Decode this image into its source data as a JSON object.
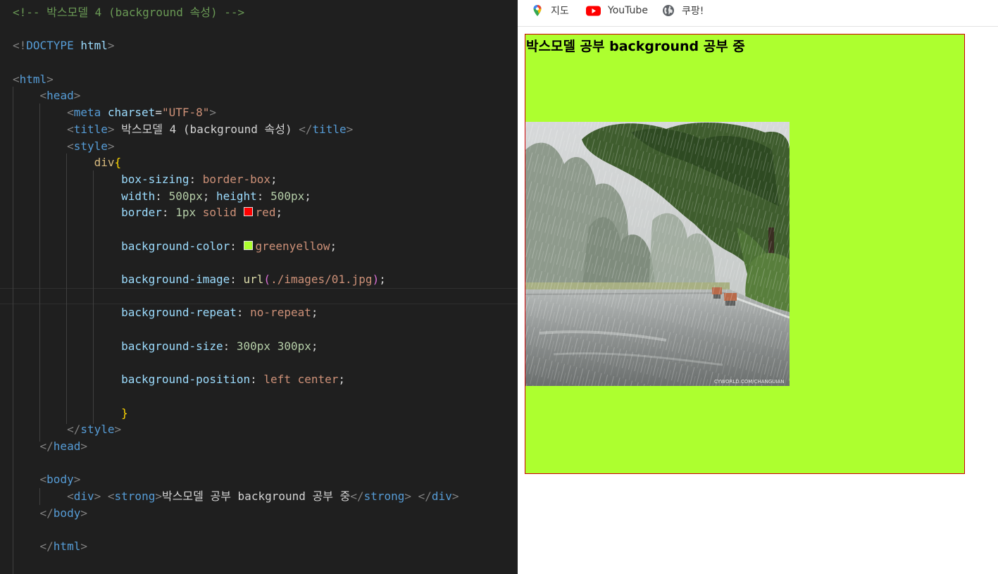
{
  "editor": {
    "lines": [
      [
        [
          "c-com",
          "<!-- 박스모델 4 (background 속성) -->"
        ]
      ],
      [],
      [
        [
          "c-br",
          "<!"
        ],
        [
          "c-tag",
          "DOCTYPE"
        ],
        [
          "c-txt",
          " "
        ],
        [
          "c-atn",
          "html"
        ],
        [
          "c-br",
          ">"
        ]
      ],
      [],
      [
        [
          "c-br",
          "<"
        ],
        [
          "c-tag",
          "html"
        ],
        [
          "c-br",
          ">"
        ]
      ],
      [
        [
          "c-txt",
          "    "
        ],
        [
          "c-br",
          "<"
        ],
        [
          "c-tag",
          "head"
        ],
        [
          "c-br",
          ">"
        ]
      ],
      [
        [
          "c-txt",
          "        "
        ],
        [
          "c-br",
          "<"
        ],
        [
          "c-tag",
          "meta"
        ],
        [
          "c-txt",
          " "
        ],
        [
          "c-atn",
          "charset"
        ],
        [
          "c-txt",
          "="
        ],
        [
          "c-atv",
          "\"UTF-8\""
        ],
        [
          "c-br",
          ">"
        ]
      ],
      [
        [
          "c-txt",
          "        "
        ],
        [
          "c-br",
          "<"
        ],
        [
          "c-tag",
          "title"
        ],
        [
          "c-br",
          ">"
        ],
        [
          "c-txt",
          " 박스모델 4 (background 속성) "
        ],
        [
          "c-br",
          "</"
        ],
        [
          "c-tag",
          "title"
        ],
        [
          "c-br",
          ">"
        ]
      ],
      [
        [
          "c-txt",
          "        "
        ],
        [
          "c-br",
          "<"
        ],
        [
          "c-tag",
          "style"
        ],
        [
          "c-br",
          ">"
        ]
      ],
      [
        [
          "c-txt",
          "            "
        ],
        [
          "c-sel",
          "div"
        ],
        [
          "c-brk",
          "{"
        ]
      ],
      [
        [
          "c-txt",
          "                "
        ],
        [
          "c-prp",
          "box-sizing"
        ],
        [
          "c-txt",
          ": "
        ],
        [
          "c-val",
          "border-box"
        ],
        [
          "c-txt",
          ";"
        ]
      ],
      [
        [
          "c-txt",
          "                "
        ],
        [
          "c-prp",
          "width"
        ],
        [
          "c-txt",
          ": "
        ],
        [
          "c-num",
          "500px"
        ],
        [
          "c-txt",
          "; "
        ],
        [
          "c-prp",
          "height"
        ],
        [
          "c-txt",
          ": "
        ],
        [
          "c-num",
          "500px"
        ],
        [
          "c-txt",
          ";"
        ]
      ],
      [
        [
          "c-txt",
          "                "
        ],
        [
          "c-prp",
          "border"
        ],
        [
          "c-txt",
          ": "
        ],
        [
          "c-num",
          "1px"
        ],
        [
          "c-txt",
          " "
        ],
        [
          "c-val",
          "solid"
        ],
        [
          "c-txt",
          " "
        ],
        [
          "swatch",
          "#ff0000"
        ],
        [
          "c-val",
          "red"
        ],
        [
          "c-txt",
          ";"
        ]
      ],
      [],
      [
        [
          "c-txt",
          "                "
        ],
        [
          "c-prp",
          "background-color"
        ],
        [
          "c-txt",
          ": "
        ],
        [
          "swatch",
          "#adff2f"
        ],
        [
          "c-val",
          "greenyellow"
        ],
        [
          "c-txt",
          ";"
        ]
      ],
      [],
      [
        [
          "c-txt",
          "                "
        ],
        [
          "c-prp",
          "background-image"
        ],
        [
          "c-txt",
          ": "
        ],
        [
          "c-fn",
          "url"
        ],
        [
          "c-brk2",
          "("
        ],
        [
          "c-val",
          "./images/01.jpg"
        ],
        [
          "c-brk2",
          ")"
        ],
        [
          "c-txt",
          ";"
        ]
      ],
      [],
      [
        [
          "c-txt",
          "                "
        ],
        [
          "c-prp",
          "background-repeat"
        ],
        [
          "c-txt",
          ": "
        ],
        [
          "c-val",
          "no-repeat"
        ],
        [
          "c-txt",
          ";"
        ]
      ],
      [],
      [
        [
          "c-txt",
          "                "
        ],
        [
          "c-prp",
          "background-size"
        ],
        [
          "c-txt",
          ": "
        ],
        [
          "c-num",
          "300px"
        ],
        [
          "c-txt",
          " "
        ],
        [
          "c-num",
          "300px"
        ],
        [
          "c-txt",
          ";"
        ]
      ],
      [],
      [
        [
          "c-txt",
          "                "
        ],
        [
          "c-prp",
          "background-position"
        ],
        [
          "c-txt",
          ": "
        ],
        [
          "c-val",
          "left"
        ],
        [
          "c-txt",
          " "
        ],
        [
          "c-val",
          "center"
        ],
        [
          "c-txt",
          ";"
        ]
      ],
      [],
      [
        [
          "c-txt",
          "                "
        ],
        [
          "c-brk",
          "}"
        ]
      ],
      [
        [
          "c-txt",
          "        "
        ],
        [
          "c-br",
          "</"
        ],
        [
          "c-tag",
          "style"
        ],
        [
          "c-br",
          ">"
        ]
      ],
      [
        [
          "c-txt",
          "    "
        ],
        [
          "c-br",
          "</"
        ],
        [
          "c-tag",
          "head"
        ],
        [
          "c-br",
          ">"
        ]
      ],
      [],
      [
        [
          "c-txt",
          "    "
        ],
        [
          "c-br",
          "<"
        ],
        [
          "c-tag",
          "body"
        ],
        [
          "c-br",
          ">"
        ]
      ],
      [
        [
          "c-txt",
          "        "
        ],
        [
          "c-br",
          "<"
        ],
        [
          "c-tag",
          "div"
        ],
        [
          "c-br",
          ">"
        ],
        [
          "c-txt",
          " "
        ],
        [
          "c-br",
          "<"
        ],
        [
          "c-tag",
          "strong"
        ],
        [
          "c-br",
          ">"
        ],
        [
          "c-txt",
          "박스모델 공부 background 공부 중"
        ],
        [
          "c-br",
          "</"
        ],
        [
          "c-tag",
          "strong"
        ],
        [
          "c-br",
          ">"
        ],
        [
          "c-txt",
          " "
        ],
        [
          "c-br",
          "</"
        ],
        [
          "c-tag",
          "div"
        ],
        [
          "c-br",
          ">"
        ]
      ],
      [
        [
          "c-txt",
          "    "
        ],
        [
          "c-br",
          "</"
        ],
        [
          "c-tag",
          "body"
        ],
        [
          "c-br",
          ">"
        ]
      ],
      [],
      [
        [
          "c-txt",
          "    "
        ],
        [
          "c-br",
          "</"
        ],
        [
          "c-tag",
          "html"
        ],
        [
          "c-br",
          ">"
        ]
      ],
      []
    ],
    "current_line": 17
  },
  "browser": {
    "bookmarks": [
      {
        "label": "지도",
        "icon": "google-maps-icon"
      },
      {
        "label": "YouTube",
        "icon": "youtube-icon"
      },
      {
        "label": "쿠팡!",
        "icon": "globe-icon"
      }
    ],
    "demo_text": "박스모델 공부 background 공부 중",
    "demo_image_watermark": "CYWORLD.COM/CHANGUIAN",
    "colors": {
      "box_background": "#adff2f",
      "box_border": "#cc0000"
    }
  }
}
